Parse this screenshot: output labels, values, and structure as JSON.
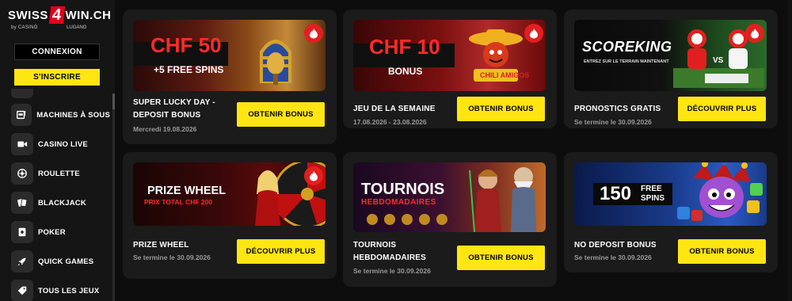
{
  "brand": {
    "logo_left": "SWISS",
    "logo_four": "4",
    "logo_right": "WIN.CH",
    "logo_sub_left": "by CASINÒ",
    "logo_sub_right": "LUGANO"
  },
  "auth": {
    "login_label": "CONNEXION",
    "signup_label": "S'INSCRIRE"
  },
  "nav": {
    "items": [
      {
        "label": "MACHINES À SOUS",
        "icon": "slot-machine-icon"
      },
      {
        "label": "CASINO LIVE",
        "icon": "live-camera-icon"
      },
      {
        "label": "ROULETTE",
        "icon": "roulette-icon"
      },
      {
        "label": "BLACKJACK",
        "icon": "cards-icon"
      },
      {
        "label": "POKER",
        "icon": "poker-chip-icon"
      },
      {
        "label": "QUICK GAMES",
        "icon": "rocket-icon"
      },
      {
        "label": "TOUS LES JEUX",
        "icon": "tag-icon"
      }
    ]
  },
  "promos": [
    {
      "title_line1": "SUPER LUCKY DAY -",
      "title_line2": "DEPOSIT BONUS",
      "subtitle": "Mercredi  19.08.2026",
      "cta": "OBTENIR BONUS",
      "banner_line1": "CHF 50",
      "banner_line2": "+5  FREE SPINS"
    },
    {
      "title_line1": "JEU DE LA SEMAINE",
      "subtitle": "17.08.2026 - 23.08.2026",
      "cta": "OBTENIR BONUS",
      "banner_line1": "CHF 10",
      "banner_line2": "BONUS",
      "banner_game": "CHILI AMIGOS"
    },
    {
      "title_line1": "PRONOSTICS GRATIS",
      "subtitle": "Se termine le 30.09.2026",
      "cta": "DÉCOUVRIR PLUS",
      "banner_brand": "SCOREKING",
      "banner_tagline": "ENTREZ SUR LE TERRAIN MAINTENANT"
    },
    {
      "title_line1": "PRIZE WHEEL",
      "subtitle": "Se termine le 30.09.2026",
      "cta": "DÉCOUVRIR PLUS",
      "banner_line1": "PRIZE WHEEL",
      "banner_line2": "PRIX TOTAL CHF 200"
    },
    {
      "title_line1": "TOURNOIS",
      "title_line2": "HEBDOMADAIRES",
      "subtitle": "Se termine le 30.09.2026",
      "cta": "OBTENIR BONUS",
      "banner_line1": "TOURNOIS",
      "banner_line2": "HEBDOMADAIRES"
    },
    {
      "title_line1": "NO DEPOSIT BONUS",
      "subtitle": "Se termine le 30.09.2026",
      "cta": "OBTENIR BONUS",
      "banner_line1": "150",
      "banner_line2": "FREE",
      "banner_line3": "SPINS"
    }
  ],
  "colors": {
    "accent_yellow": "#ffe511",
    "brand_red": "#e3001b",
    "card_bg": "#1b1b1b",
    "page_bg": "#0d0d0d"
  }
}
